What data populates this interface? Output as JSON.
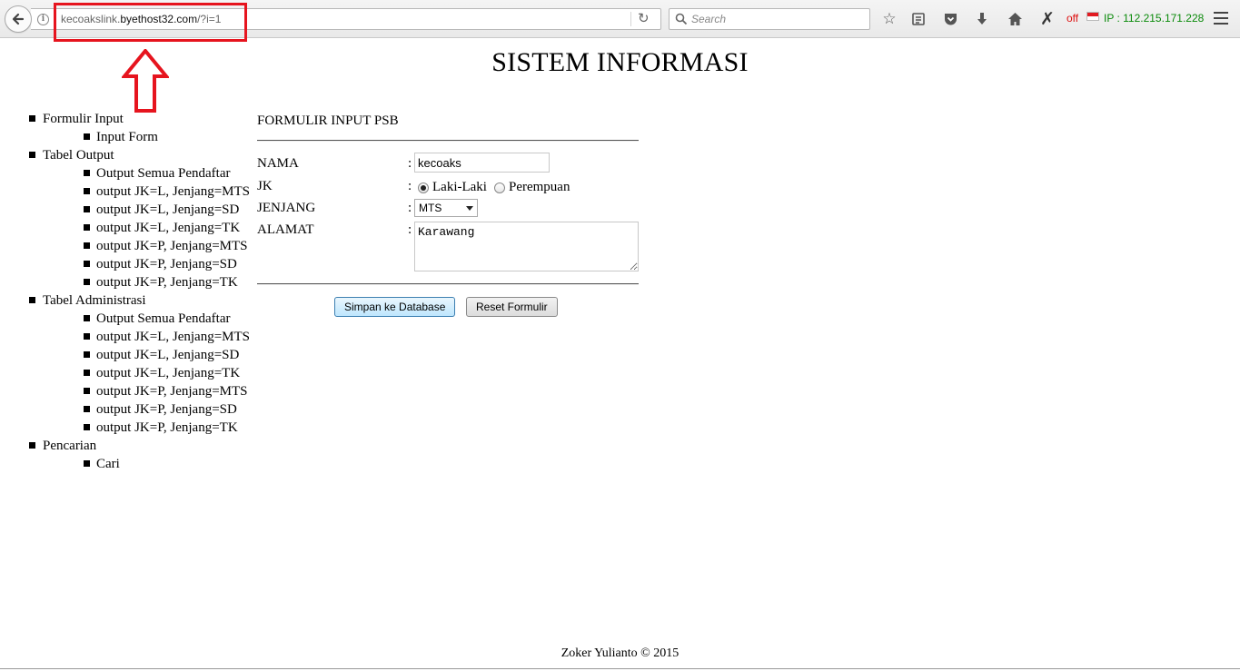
{
  "browser": {
    "url_prefix": "kecoakslink.",
    "url_host": "byethost32.com",
    "url_path": "/?i=1",
    "search_placeholder": "Search",
    "status_off": "off",
    "ip_label": "IP : 112.215.171.228",
    "colors": {
      "annotation": "#e6141e",
      "ip_text": "#0a8a0a",
      "off_text": "#d11111"
    }
  },
  "page": {
    "title": "SISTEM INFORMASI",
    "footer": "Zoker Yulianto © 2015"
  },
  "sidebar": {
    "sections": [
      {
        "label": "Formulir Input",
        "items": [
          "Input Form"
        ]
      },
      {
        "label": "Tabel Output",
        "items": [
          "Output Semua Pendaftar",
          "output JK=L, Jenjang=MTS",
          "output JK=L, Jenjang=SD",
          "output JK=L, Jenjang=TK",
          "output JK=P, Jenjang=MTS",
          "output JK=P, Jenjang=SD",
          "output JK=P, Jenjang=TK"
        ]
      },
      {
        "label": "Tabel Administrasi",
        "items": [
          "Output Semua Pendaftar",
          "output JK=L, Jenjang=MTS",
          "output JK=L, Jenjang=SD",
          "output JK=L, Jenjang=TK",
          "output JK=P, Jenjang=MTS",
          "output JK=P, Jenjang=SD",
          "output JK=P, Jenjang=TK"
        ]
      },
      {
        "label": "Pencarian",
        "items": [
          "Cari"
        ]
      }
    ]
  },
  "form": {
    "heading": "FORMULIR INPUT PSB",
    "colon": ":",
    "nama": {
      "label": "NAMA",
      "value": "kecoaks"
    },
    "jk": {
      "label": "JK",
      "option_l": "Laki-Laki",
      "option_p": "Perempuan",
      "selected": "Laki-Laki"
    },
    "jenjang": {
      "label": "JENJANG",
      "selected": "MTS"
    },
    "alamat": {
      "label": "ALAMAT",
      "value": "Karawang"
    },
    "save_label": "Simpan ke Database",
    "reset_label": "Reset Formulir"
  }
}
